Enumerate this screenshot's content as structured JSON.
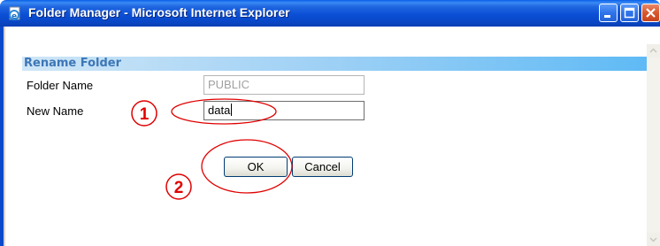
{
  "window": {
    "title": "Folder Manager - Microsoft Internet Explorer"
  },
  "icons": [
    "ie-page-icon",
    "minimize-icon",
    "maximize-icon",
    "close-icon",
    "scroll-up-arrow-icon",
    "scroll-down-arrow-icon"
  ],
  "form": {
    "section_title": "Rename Folder",
    "folder_name_label": "Folder Name",
    "folder_name_value": "PUBLIC",
    "new_name_label": "New Name",
    "new_name_value": "data",
    "ok_label": "OK",
    "cancel_label": "Cancel"
  },
  "annotations": {
    "step1": "1",
    "step2": "2",
    "color": "#e00000"
  },
  "colors": {
    "titlebar": "#0b4fd6",
    "section_header_text": "#3d76b6",
    "section_header_bg": "#5fbaf5"
  }
}
